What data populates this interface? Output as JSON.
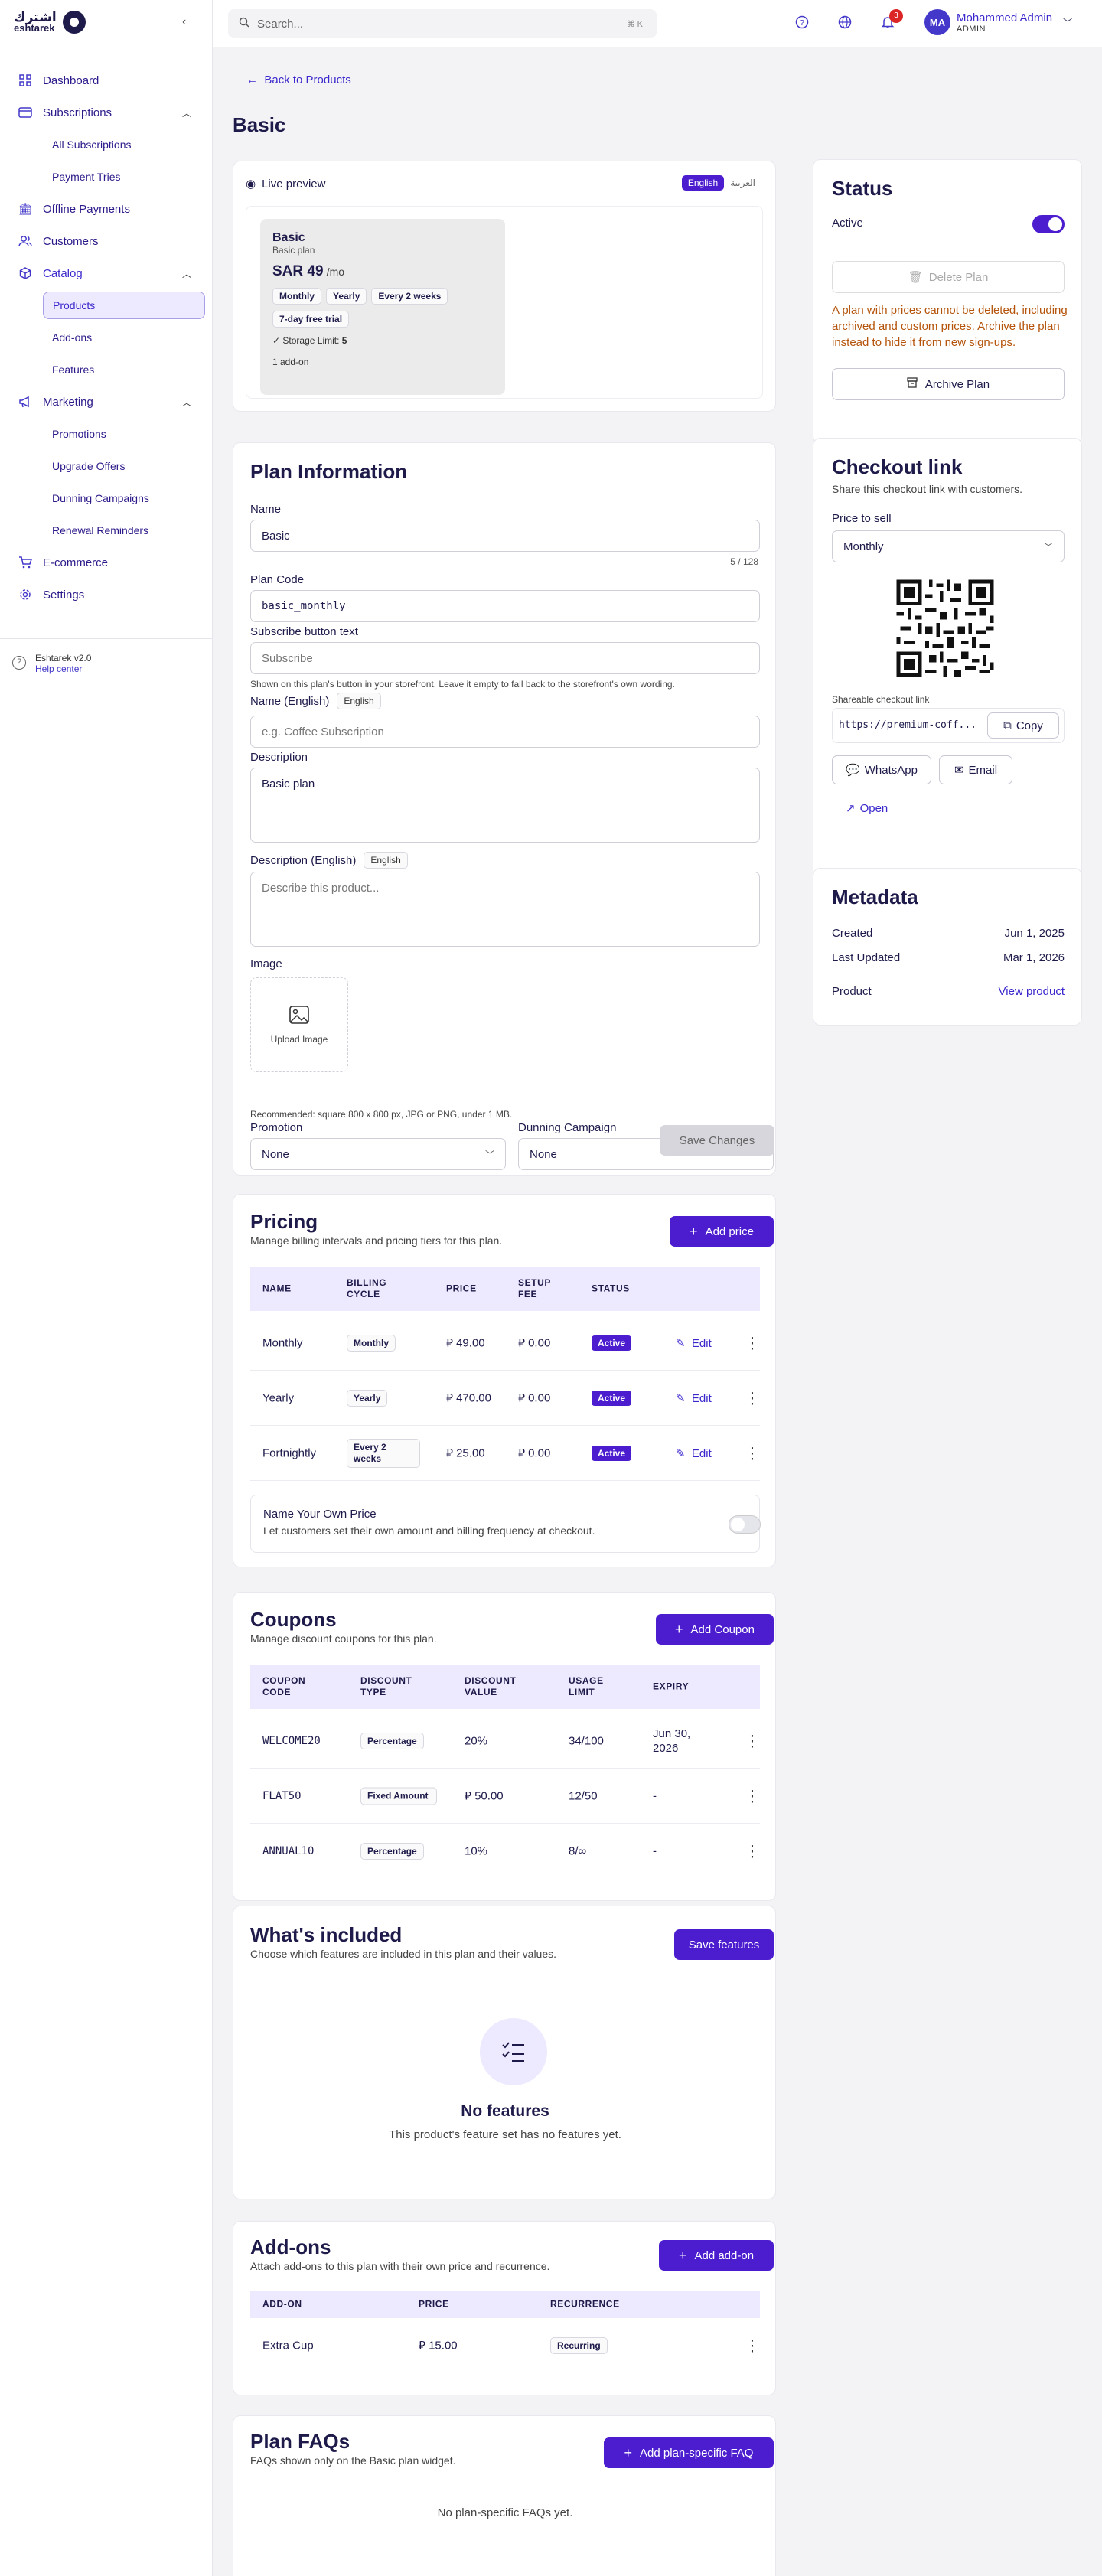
{
  "brand": {
    "name_ar": "اشترك",
    "name_en": "eshtarek"
  },
  "sidebar": {
    "items": [
      {
        "label": "Dashboard",
        "icon": "grid-icon"
      },
      {
        "label": "Subscriptions",
        "icon": "card-icon",
        "expanded": true,
        "children": [
          "All Subscriptions",
          "Payment Tries"
        ]
      },
      {
        "label": "Offline Payments",
        "icon": "bank-icon"
      },
      {
        "label": "Customers",
        "icon": "users-icon"
      },
      {
        "label": "Catalog",
        "icon": "box-icon",
        "expanded": true,
        "children": [
          "Products",
          "Add-ons",
          "Features"
        ]
      },
      {
        "label": "Marketing",
        "icon": "megaphone-icon",
        "expanded": true,
        "children": [
          "Promotions",
          "Upgrade Offers",
          "Dunning Campaigns",
          "Renewal Reminders"
        ]
      },
      {
        "label": "E-commerce",
        "icon": "cart-icon"
      },
      {
        "label": "Settings",
        "icon": "gear-icon"
      }
    ],
    "active_child": "Products",
    "footer": {
      "version": "Eshtarek v2.0",
      "help": "Help center"
    }
  },
  "topbar": {
    "search_placeholder": "Search...",
    "search_shortcut": "⌘ K",
    "notifications_count": "3",
    "user": {
      "initials": "MA",
      "name": "Mohammed Admin",
      "role": "ADMIN"
    }
  },
  "page": {
    "back_label": "Back to Products",
    "title": "Basic"
  },
  "preview": {
    "label": "Live preview",
    "lang_en": "English",
    "lang_ar": "العربية",
    "plan_name": "Basic",
    "plan_desc": "Basic plan",
    "price": "SAR 49",
    "per": "/mo",
    "cycles": [
      "Monthly",
      "Yearly",
      "Every 2 weeks"
    ],
    "trial": "7-day free trial",
    "feature": "Storage Limit:",
    "feature_value": "5",
    "addons": "1 add-on"
  },
  "plan_info": {
    "title": "Plan Information",
    "name_label": "Name",
    "name_value": "Basic",
    "name_count": "5 / 128",
    "code_label": "Plan Code",
    "code_value": "basic_monthly",
    "subscribe_label": "Subscribe button text",
    "subscribe_placeholder": "Subscribe",
    "subscribe_hint": "Shown on this plan's button in your storefront. Leave it empty to fall back to the storefront's own wording.",
    "name_en_label": "Name (English)",
    "name_en_tag": "English",
    "name_en_placeholder": "e.g. Coffee Subscription",
    "desc_label": "Description",
    "desc_value": "Basic plan",
    "desc_en_label": "Description (English)",
    "desc_en_tag": "English",
    "desc_en_placeholder": "Describe this product...",
    "image_label": "Image",
    "upload_label": "Upload Image",
    "image_hint": "Recommended: square 800 x 800 px, JPG or PNG, under 1 MB.",
    "promotion_label": "Promotion",
    "promotion_value": "None",
    "dunning_label": "Dunning Campaign",
    "dunning_value": "None",
    "save_label": "Save Changes"
  },
  "pricing": {
    "title": "Pricing",
    "subtitle": "Manage billing intervals and pricing tiers for this plan.",
    "add_label": "Add price",
    "headers": [
      "NAME",
      "BILLING CYCLE",
      "PRICE",
      "SETUP FEE",
      "STATUS"
    ],
    "rows": [
      {
        "name": "Monthly",
        "cycle": "Monthly",
        "price": "49.00",
        "setup": "0.00",
        "status": "Active"
      },
      {
        "name": "Yearly",
        "cycle": "Yearly",
        "price": "470.00",
        "setup": "0.00",
        "status": "Active"
      },
      {
        "name": "Fortnightly",
        "cycle": "Every 2 weeks",
        "price": "25.00",
        "setup": "0.00",
        "status": "Active"
      }
    ],
    "edit_label": "Edit",
    "nyop_title": "Name Your Own Price",
    "nyop_desc": "Let customers set their own amount and billing frequency at checkout."
  },
  "coupons": {
    "title": "Coupons",
    "subtitle": "Manage discount coupons for this plan.",
    "add_label": "Add Coupon",
    "headers": [
      "COUPON CODE",
      "DISCOUNT TYPE",
      "DISCOUNT VALUE",
      "USAGE LIMIT",
      "EXPIRY"
    ],
    "rows": [
      {
        "code": "WELCOME20",
        "type": "Percentage",
        "value": "20%",
        "usage": "34/100",
        "expiry": "Jun 30, 2026"
      },
      {
        "code": "FLAT50",
        "type": "Fixed Amount",
        "value": "50.00",
        "usage": "12/50",
        "expiry": "-"
      },
      {
        "code": "ANNUAL10",
        "type": "Percentage",
        "value": "10%",
        "usage": "8/∞",
        "expiry": "-"
      }
    ]
  },
  "features": {
    "title": "What's included",
    "subtitle": "Choose which features are included in this plan and their values.",
    "save_label": "Save features",
    "empty_title": "No features",
    "empty_desc": "This product's feature set has no features yet."
  },
  "addons": {
    "title": "Add-ons",
    "subtitle": "Attach add-ons to this plan with their own price and recurrence.",
    "add_label": "Add add-on",
    "headers": [
      "ADD-ON",
      "PRICE",
      "RECURRENCE"
    ],
    "rows": [
      {
        "name": "Extra Cup",
        "price": "15.00",
        "recurrence": "Recurring"
      }
    ]
  },
  "faqs": {
    "title": "Plan FAQs",
    "subtitle": "FAQs shown only on the Basic plan widget.",
    "add_label": "Add plan-specific FAQ",
    "empty": "No plan-specific FAQs yet."
  },
  "status": {
    "title": "Status",
    "active_label": "Active",
    "active": true,
    "delete_label": "Delete Plan",
    "warning": "A plan with prices cannot be deleted, including archived and custom prices. Archive the plan instead to hide it from new sign-ups.",
    "archive_label": "Archive Plan"
  },
  "checkout": {
    "title": "Checkout link",
    "subtitle": "Share this checkout link with customers.",
    "price_label": "Price to sell",
    "price_value": "Monthly",
    "link_label": "Shareable checkout link",
    "link_value": "https://premium-coff...",
    "copy_label": "Copy",
    "whatsapp_label": "WhatsApp",
    "email_label": "Email",
    "open_label": "Open"
  },
  "metadata": {
    "title": "Metadata",
    "created_label": "Created",
    "created_value": "Jun 1, 2025",
    "updated_label": "Last Updated",
    "updated_value": "Mar 1, 2026",
    "product_label": "Product",
    "product_value": "View product"
  },
  "colors": {
    "accent": "#4c1dcf",
    "accent_light": "#ede9fe",
    "text": "#1e1b4b",
    "warning": "#b45309"
  }
}
